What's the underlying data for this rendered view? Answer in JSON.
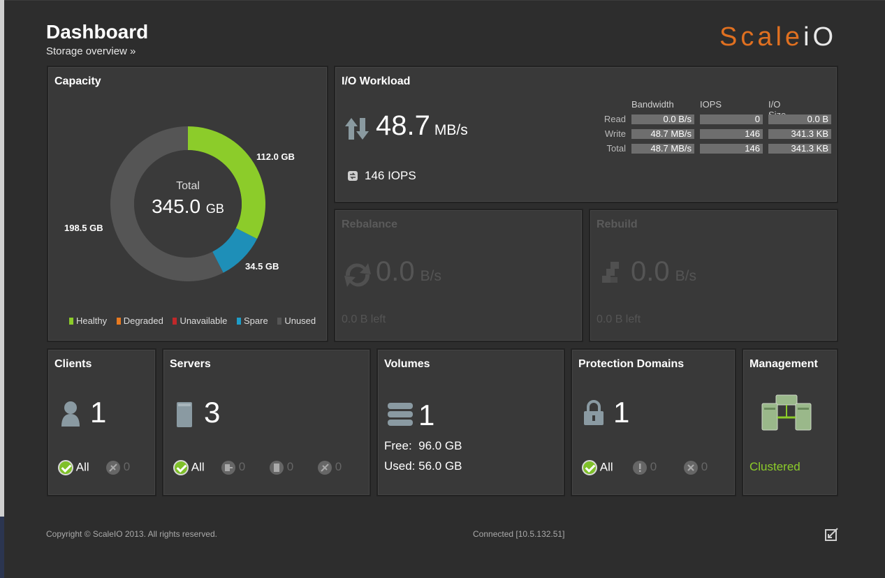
{
  "header": {
    "title": "Dashboard",
    "subtitle": "Storage overview »",
    "logo_a": "Scale",
    "logo_b": "iO"
  },
  "capacity": {
    "title": "Capacity",
    "total_label": "Total",
    "total_value": "345.0",
    "total_unit": "GB",
    "segments": [
      {
        "name": "Healthy",
        "value": 112.0,
        "color": "#8ccc2a"
      },
      {
        "name": "Spare",
        "value": 34.5,
        "color": "#1e8fb8"
      },
      {
        "name": "Unused",
        "value": 198.5,
        "color": "#555555"
      }
    ],
    "labels": {
      "healthy": "112.0 GB",
      "spare": "34.5 GB",
      "unused": "198.5 GB"
    },
    "legend": [
      {
        "label": "Healthy",
        "color": "#8ccc2a"
      },
      {
        "label": "Degraded",
        "color": "#e87a20"
      },
      {
        "label": "Unavailable",
        "color": "#c0282a"
      },
      {
        "label": "Spare",
        "color": "#1e9dc8"
      },
      {
        "label": "Unused",
        "color": "#555555"
      }
    ]
  },
  "io": {
    "title": "I/O Workload",
    "bandwidth_value": "48.7",
    "bandwidth_unit": "MB/s",
    "iops_text": "146 IOPS",
    "columns": [
      "Bandwidth",
      "IOPS",
      "I/O Size"
    ],
    "rows": [
      {
        "label": "Read",
        "bandwidth": "0.0 B/s",
        "iops": "0",
        "size": "0.0 B"
      },
      {
        "label": "Write",
        "bandwidth": "48.7 MB/s",
        "iops": "146",
        "size": "341.3 KB"
      },
      {
        "label": "Total",
        "bandwidth": "48.7 MB/s",
        "iops": "146",
        "size": "341.3 KB"
      }
    ]
  },
  "rebalance": {
    "title": "Rebalance",
    "value": "0.0",
    "unit": "B/s",
    "left": "0.0 B left"
  },
  "rebuild": {
    "title": "Rebuild",
    "value": "0.0",
    "unit": "B/s",
    "left": "0.0 B left"
  },
  "clients": {
    "title": "Clients",
    "count": "1",
    "all_label": "All",
    "disconnected": "0"
  },
  "servers": {
    "title": "Servers",
    "count": "3",
    "all_label": "All",
    "s1": "0",
    "s2": "0",
    "s3": "0"
  },
  "volumes": {
    "title": "Volumes",
    "count": "1",
    "free": "Free:  96.0 GB",
    "used": "Used: 56.0 GB"
  },
  "protection": {
    "title": "Protection Domains",
    "count": "1",
    "all_label": "All",
    "warn": "0",
    "err": "0"
  },
  "management": {
    "title": "Management",
    "status": "Clustered",
    "status_color": "#8ccc2a"
  },
  "footer": {
    "copyright": "Copyright © ScaleIO 2013. All rights reserved.",
    "connected": "Connected [10.5.132.51]"
  }
}
